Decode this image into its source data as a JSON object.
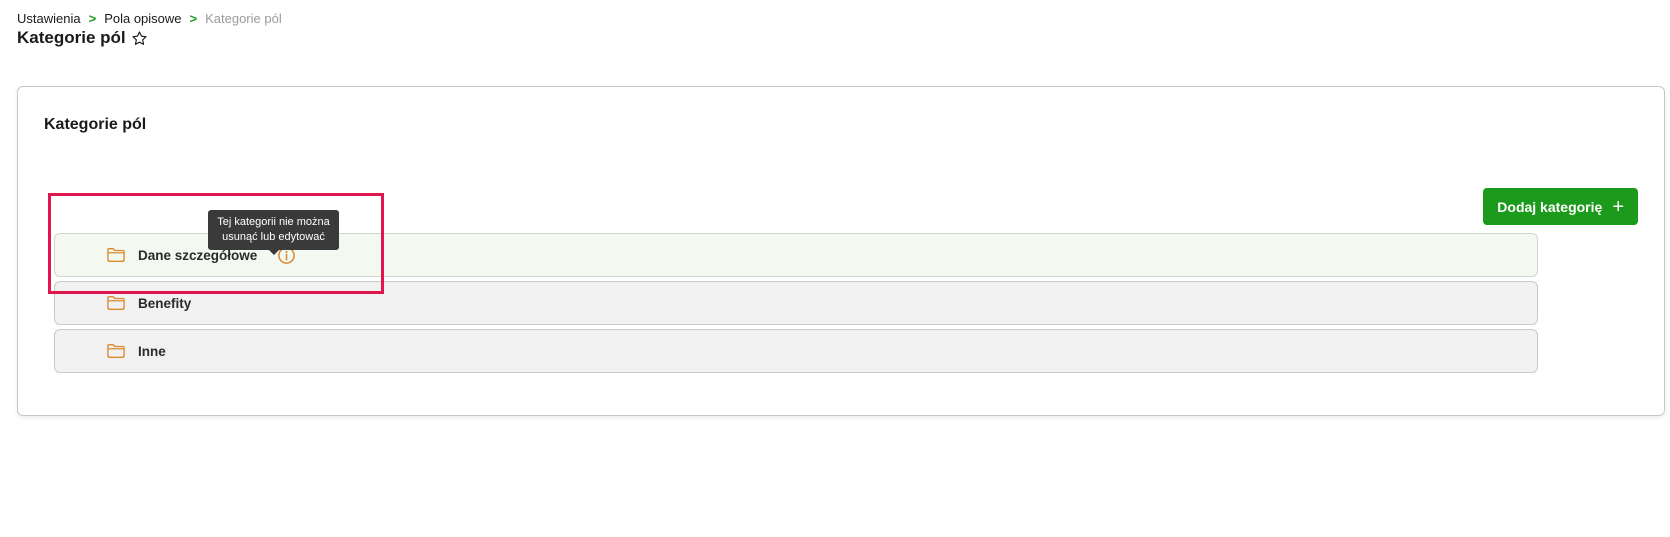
{
  "breadcrumb": {
    "items": [
      "Ustawienia",
      "Pola opisowe",
      "Kategorie pól"
    ],
    "separator": ">"
  },
  "page": {
    "title": "Kategorie pól",
    "favorite_icon": "star-outline-icon"
  },
  "card": {
    "title": "Kategorie pól",
    "add_button": {
      "label": "Dodaj kategorię",
      "icon": "+"
    }
  },
  "categories": [
    {
      "label": "Dane szczegółowe",
      "icon": "folder-icon",
      "has_info": true
    },
    {
      "label": "Benefity",
      "icon": "folder-icon",
      "has_info": false
    },
    {
      "label": "Inne",
      "icon": "folder-icon",
      "has_info": false
    }
  ],
  "tooltip": {
    "line1": "Tej kategorii nie można",
    "line2": "usunąć lub edytować"
  },
  "colors": {
    "accent": "#1b9a1b",
    "folder": "#d98a2b",
    "highlight": "#e0164f"
  }
}
